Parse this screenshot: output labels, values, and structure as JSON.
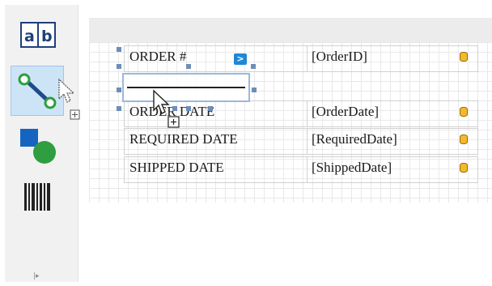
{
  "toolbox": {
    "tools": [
      {
        "name": "label",
        "icon": "label-ab-icon",
        "text": "a|b"
      },
      {
        "name": "line",
        "icon": "line-tool-icon",
        "selected": true
      },
      {
        "name": "shape",
        "icon": "shape-icon"
      },
      {
        "name": "barcode",
        "icon": "barcode-icon"
      }
    ],
    "collapse_icon": "expand-panel-icon",
    "collapse_glyph": "|▸"
  },
  "colors": {
    "selected_tool_bg": "#cde4f7",
    "accent_blue": "#1e88d8",
    "shape_square": "#1565c0",
    "shape_circle": "#2e9e3f",
    "db_field_icon": "#f3b92e"
  },
  "report": {
    "rows": [
      {
        "label": "ORDER #",
        "field": "[OrderID]"
      },
      {
        "label": "ORDER DATE",
        "field": "[OrderDate]"
      },
      {
        "label": "REQUIRED DATE",
        "field": "[RequiredDate]"
      },
      {
        "label": "SHIPPED DATE",
        "field": "[ShippedDate]"
      }
    ],
    "smart_tag_glyph": ">"
  }
}
